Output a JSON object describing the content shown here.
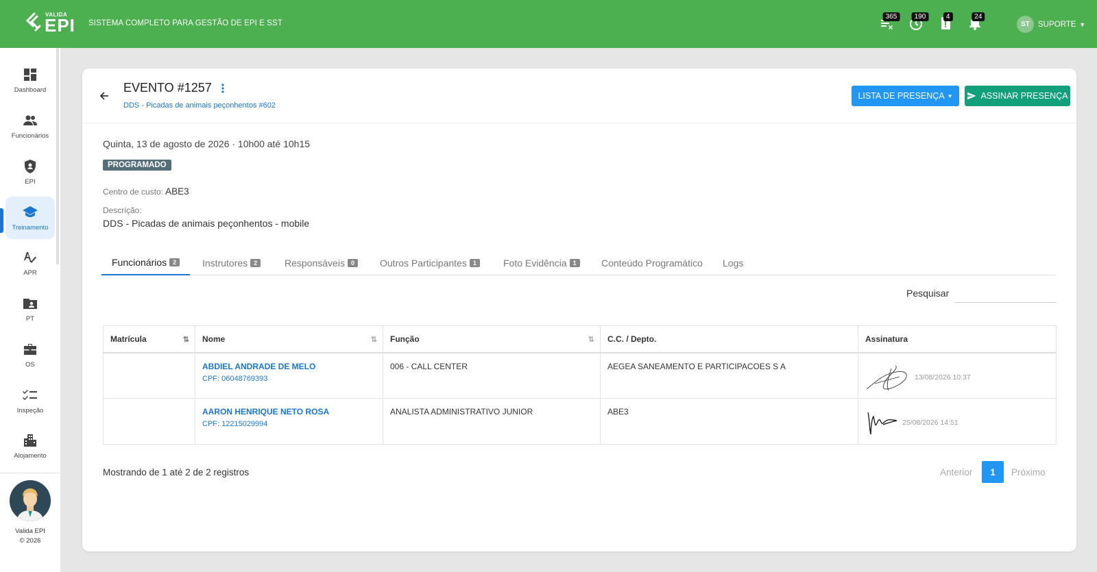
{
  "header": {
    "logo_small": "VALIDA",
    "logo_big": "EPI",
    "system_title": "SISTEMA COMPLETO PARA GESTÃO DE EPI E SST",
    "icons": [
      {
        "name": "expired-icon",
        "badge": "365"
      },
      {
        "name": "history-icon",
        "badge": "190"
      },
      {
        "name": "document-alert-icon",
        "badge": "4"
      },
      {
        "name": "bell-icon",
        "badge": "24"
      }
    ],
    "user_initials": "ST",
    "user_name": "SUPORTE"
  },
  "sidebar": {
    "items": [
      {
        "label": "Dashboard",
        "icon": "dashboard-icon"
      },
      {
        "label": "Funcionários",
        "icon": "people-icon"
      },
      {
        "label": "EPI",
        "icon": "shield-icon"
      },
      {
        "label": "Treinamento",
        "icon": "graduation-cap-icon"
      },
      {
        "label": "APR",
        "icon": "spellcheck-icon"
      },
      {
        "label": "PT",
        "icon": "folder-user-icon"
      },
      {
        "label": "OS",
        "icon": "briefcase-icon"
      },
      {
        "label": "Inspeção",
        "icon": "checklist-icon"
      },
      {
        "label": "Alojamento",
        "icon": "building-icon"
      }
    ],
    "footer_name": "Valida EPI",
    "footer_year": "© 2026"
  },
  "event": {
    "title": "EVENTO #1257",
    "subtitle": "DDS - Picadas de animais peçonhentos #602",
    "btn_lista": "LISTA DE PRESENÇA",
    "btn_assinar": "ASSINAR PRESENÇA",
    "date_line": "Quinta, 13 de agosto de 2026 · 10h00 até 10h15",
    "status": "PROGRAMADO",
    "cc_label": "Centro de custo:",
    "cc_value": "ABE3",
    "desc_label": "Descrição:",
    "desc_value": "DDS - Picadas de animais peçonhentos - mobile"
  },
  "tabs": [
    {
      "label": "Funcionários",
      "count": "2"
    },
    {
      "label": "Instrutores",
      "count": "2"
    },
    {
      "label": "Responsáveis",
      "count": "0"
    },
    {
      "label": "Outros Participantes",
      "count": "1"
    },
    {
      "label": "Foto Evidência",
      "count": "1"
    },
    {
      "label": "Conteúdo Programático",
      "count": ""
    },
    {
      "label": "Logs",
      "count": ""
    }
  ],
  "search": {
    "label": "Pesquisar",
    "value": ""
  },
  "table": {
    "headers": [
      "Matrícula",
      "Nome",
      "Função",
      "C.C. / Depto.",
      "Assinatura"
    ],
    "rows": [
      {
        "matricula": "",
        "nome": "ABDIEL ANDRADE DE MELO",
        "cpf": "CPF: 06048769393",
        "funcao": "006 - CALL CENTER",
        "cc": "AEGEA SANEAMENTO E PARTICIPACOES S A",
        "sig_date": "13/08/2026 10:37"
      },
      {
        "matricula": "",
        "nome": "AARON HENRIQUE NETO ROSA",
        "cpf": "CPF: 12215029994",
        "funcao": "ANALISTA ADMINISTRATIVO JUNIOR",
        "cc": "ABE3",
        "sig_date": "25/08/2026 14:51"
      }
    ]
  },
  "pagination": {
    "showing": "Mostrando de 1 até 2 de 2 registros",
    "prev": "Anterior",
    "current": "1",
    "next": "Próximo"
  },
  "colors": {
    "topbar": "#4caf50",
    "primary": "#2196f3",
    "success": "#11a07a",
    "status": "#546e7a"
  }
}
